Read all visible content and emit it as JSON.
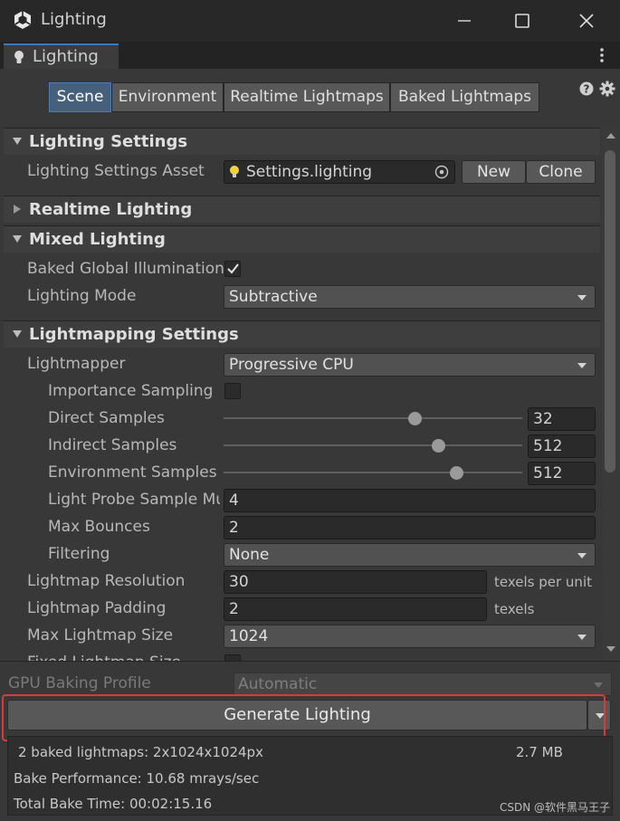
{
  "window": {
    "title": "Lighting"
  },
  "tab": {
    "label": "Lighting"
  },
  "toolbar": {
    "tabs": [
      "Scene",
      "Environment",
      "Realtime Lightmaps",
      "Baked Lightmaps"
    ],
    "active": "Scene"
  },
  "lighting_settings": {
    "header": "Lighting Settings",
    "asset_label": "Lighting Settings Asset",
    "asset_value": "Settings.lighting",
    "new_label": "New",
    "clone_label": "Clone"
  },
  "realtime_lighting": {
    "header": "Realtime Lighting"
  },
  "mixed_lighting": {
    "header": "Mixed Lighting",
    "baked_gi_label": "Baked Global Illumination",
    "baked_gi_checked": true,
    "mode_label": "Lighting Mode",
    "mode_value": "Subtractive"
  },
  "lightmapping": {
    "header": "Lightmapping Settings",
    "lightmapper_label": "Lightmapper",
    "lightmapper_value": "Progressive CPU",
    "importance_label": "Importance Sampling",
    "importance_checked": false,
    "direct_label": "Direct Samples",
    "direct_value": "32",
    "direct_fraction": 0.64,
    "indirect_label": "Indirect Samples",
    "indirect_value": "512",
    "indirect_fraction": 0.72,
    "env_label": "Environment Samples",
    "env_value": "512",
    "env_fraction": 0.78,
    "probe_label": "Light Probe Sample Mu",
    "probe_value": "4",
    "bounces_label": "Max Bounces",
    "bounces_value": "2",
    "filtering_label": "Filtering",
    "filtering_value": "None",
    "resolution_label": "Lightmap Resolution",
    "resolution_value": "30",
    "resolution_unit": "texels per unit",
    "padding_label": "Lightmap Padding",
    "padding_value": "2",
    "padding_unit": "texels",
    "maxsize_label": "Max Lightmap Size",
    "maxsize_value": "1024",
    "fixed_label": "Fixed Lightmap Size"
  },
  "bottom": {
    "gpu_label": "GPU Baking Profile",
    "gpu_value": "Automatic",
    "generate_label": "Generate Lighting",
    "stats_lightmaps": "2 baked lightmaps: 2x1024x1024px",
    "stats_size": "2.7 MB",
    "stats_perf": "Bake Performance: 10.68 mrays/sec",
    "stats_time": "Total Bake Time: 00:02:15.16"
  },
  "watermark": "CSDN @软件黑马王子",
  "colors": {
    "accent": "#3a79bb",
    "highlight": "#d93a3a",
    "active_tab": "#46607c"
  },
  "icons": [
    "unity-logo-icon",
    "lightbulb-icon",
    "minimize-icon",
    "maximize-icon",
    "close-icon",
    "kebab-menu-icon",
    "help-icon",
    "gear-icon",
    "foldout-arrow-icon",
    "object-picker-icon",
    "checkmark-icon",
    "dropdown-arrow-icon"
  ]
}
